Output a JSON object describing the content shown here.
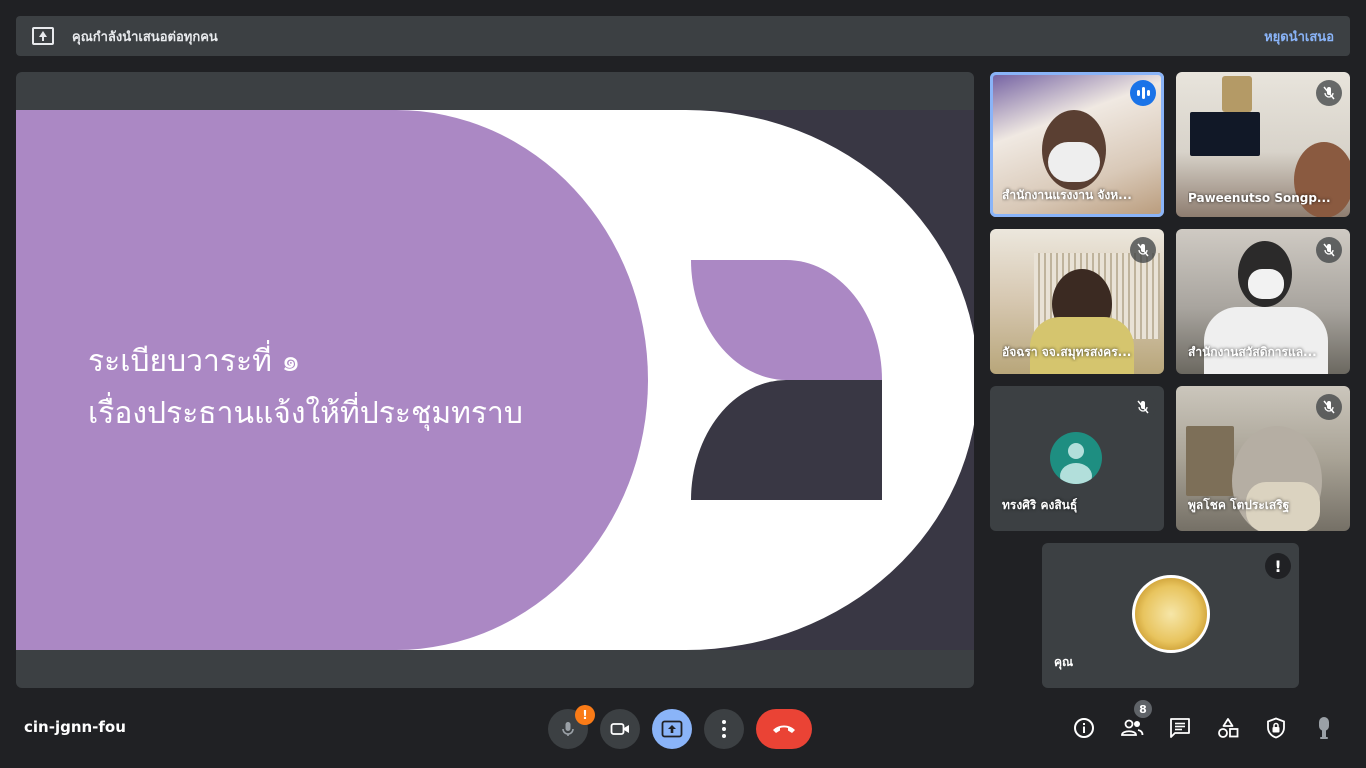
{
  "banner": {
    "message": "คุณกำลังนำเสนอต่อทุกคน",
    "stop_label": "หยุดนำเสนอ"
  },
  "slide": {
    "line1": "ระเบียบวาระที่ ๑",
    "line2": "เรื่องประธานแจ้งให้ที่ประชุมทราบ",
    "colors": {
      "purple": "#ab88c4",
      "dark": "#393744",
      "white": "#ffffff"
    }
  },
  "participants": [
    {
      "name": "สำนักงานแรงงาน จังห...",
      "speaking": true,
      "muted": false
    },
    {
      "name": "Paweenutso Songp...",
      "speaking": false,
      "muted": true
    },
    {
      "name": "อัจฉรา จจ.สมุทรสงคร...",
      "speaking": false,
      "muted": true
    },
    {
      "name": "สำนักงานสวัสดิการแล...",
      "speaking": false,
      "muted": true
    },
    {
      "name": "ทรงศิริ คงสินธุ์",
      "speaking": false,
      "muted": true
    },
    {
      "name": "พูลโชค โตประเสริฐ",
      "speaking": false,
      "muted": true
    }
  ],
  "self_tile": {
    "name": "คุณ",
    "alert": "!"
  },
  "meeting": {
    "code": "cin-jgnn-fou",
    "mic_warning": "!",
    "people_count": "8"
  },
  "icons": [
    "present-icon",
    "mic-icon",
    "camera-icon",
    "present-screen-icon",
    "more-icon",
    "hangup-icon",
    "info-icon",
    "people-icon",
    "chat-icon",
    "activities-icon",
    "host-controls-icon",
    "hand-icon",
    "mic-off-icon",
    "speaking-icon"
  ]
}
